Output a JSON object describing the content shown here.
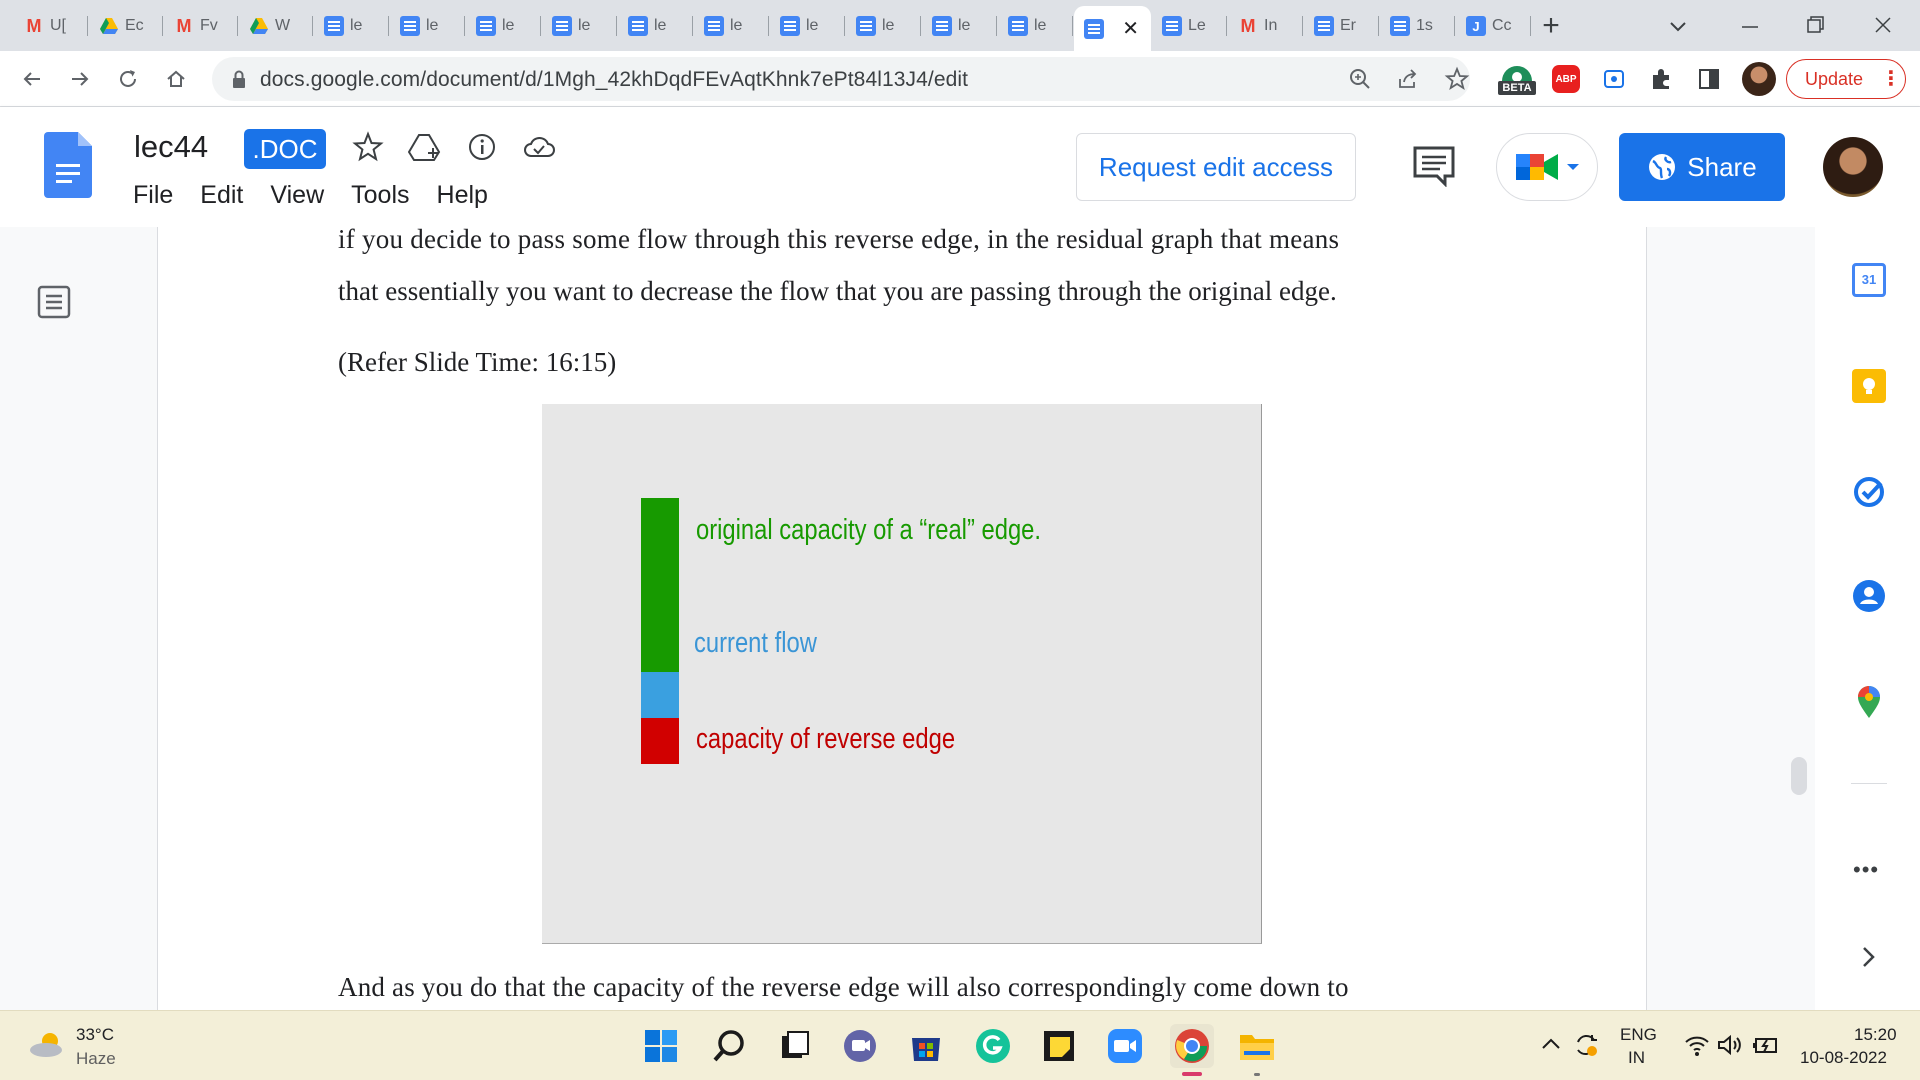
{
  "browser": {
    "tabs": [
      {
        "icon": "gmail-icon",
        "label": "U["
      },
      {
        "icon": "drive-icon",
        "label": "Ec"
      },
      {
        "icon": "gmail-icon",
        "label": "Fv"
      },
      {
        "icon": "drive-icon",
        "label": "W"
      },
      {
        "icon": "docs-icon",
        "label": "le"
      },
      {
        "icon": "docs-icon",
        "label": "le"
      },
      {
        "icon": "docs-icon",
        "label": "le"
      },
      {
        "icon": "docs-icon",
        "label": "le"
      },
      {
        "icon": "docs-icon",
        "label": "le"
      },
      {
        "icon": "docs-icon",
        "label": "le"
      },
      {
        "icon": "docs-icon",
        "label": "le"
      },
      {
        "icon": "docs-icon",
        "label": "le"
      },
      {
        "icon": "docs-icon",
        "label": "le"
      },
      {
        "icon": "docs-icon",
        "label": "le"
      },
      {
        "icon": "docs-icon",
        "label": ""
      },
      {
        "icon": "docs-icon",
        "label": "Le"
      },
      {
        "icon": "gmail-icon",
        "label": "In"
      },
      {
        "icon": "docs-icon",
        "label": "Er"
      },
      {
        "icon": "docs-icon",
        "label": "1s"
      },
      {
        "icon": "j-icon",
        "label": "Cc"
      }
    ],
    "url": "docs.google.com/document/d/1Mgh_42khDqdFEvAqtKhnk7ePt84l13J4/edit",
    "beta_badge": "BETA",
    "abp_badge": "ABP",
    "update_label": "Update"
  },
  "docs": {
    "title": "lec44",
    "badge": ".DOC",
    "menu": [
      "File",
      "Edit",
      "View",
      "Tools",
      "Help"
    ],
    "request_edit_label": "Request edit access",
    "share_label": "Share"
  },
  "document": {
    "line1": "if you decide to pass some flow through this reverse edge, in the residual graph that means",
    "line2": "that essentially you want to decrease the flow that you are passing through the original edge.",
    "slide_ref": "(Refer Slide Time: 16:15)",
    "line3": "And as you do that the capacity of the reverse edge will also correspondingly come down to",
    "slide": {
      "label_original": "original capacity of a “real” edge.",
      "label_current": "current flow",
      "label_reverse": "capacity of reverse edge",
      "colors": {
        "original": "#179a00",
        "current": "#3aa0e0",
        "reverse": "#d10000"
      }
    }
  },
  "sidepanel": {
    "calendar_day": "31"
  },
  "taskbar": {
    "temperature": "33°C",
    "weather": "Haze",
    "lang_line1": "ENG",
    "lang_line2": "IN",
    "time": "15:20",
    "date": "10-08-2022"
  }
}
